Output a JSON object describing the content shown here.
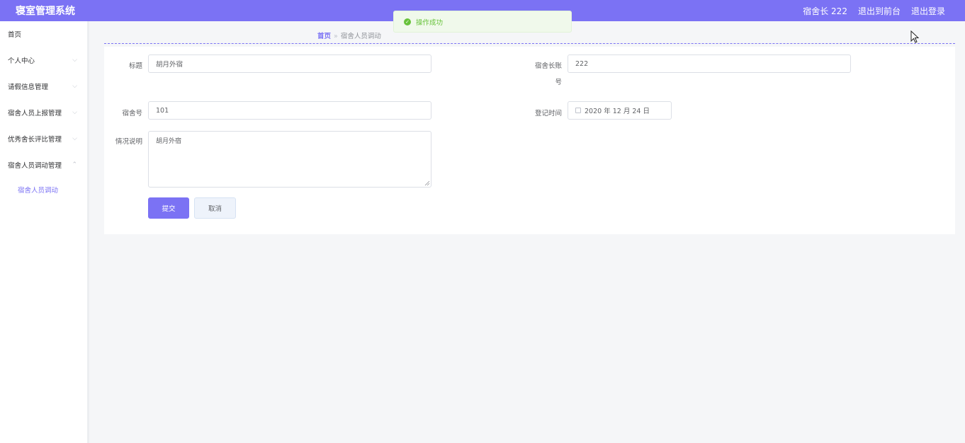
{
  "header": {
    "app_title": "寝室管理系统",
    "user_label": "宿舍长 222",
    "back_to_front": "退出到前台",
    "logout": "退出登录"
  },
  "toast": {
    "message": "操作成功"
  },
  "sidebar": {
    "items": [
      {
        "label": "首页"
      },
      {
        "label": "个人中心"
      },
      {
        "label": "请假信息管理"
      },
      {
        "label": "宿舍人员上报管理"
      },
      {
        "label": "优秀舍长评比管理"
      },
      {
        "label": "宿舍人员调动管理"
      }
    ],
    "sub_item": "宿舍人员调动"
  },
  "breadcrumb": {
    "home": "首页",
    "separator": "»",
    "current": "宿舍人员调动"
  },
  "form": {
    "title_label": "标题",
    "title_value": "胡月外宿",
    "leader_account_label_1": "宿舍长账",
    "leader_account_label_2": "号",
    "leader_account_value": "222",
    "room_label": "宿舍号",
    "room_value": "101",
    "date_label": "登记时间",
    "date_value": "2020 年 12 月 24 日",
    "desc_label": "情况说明",
    "desc_value": "胡月外宿",
    "submit": "提交",
    "cancel": "取消"
  },
  "colors": {
    "accent": "#7b72f4",
    "success": "#67c23a"
  }
}
